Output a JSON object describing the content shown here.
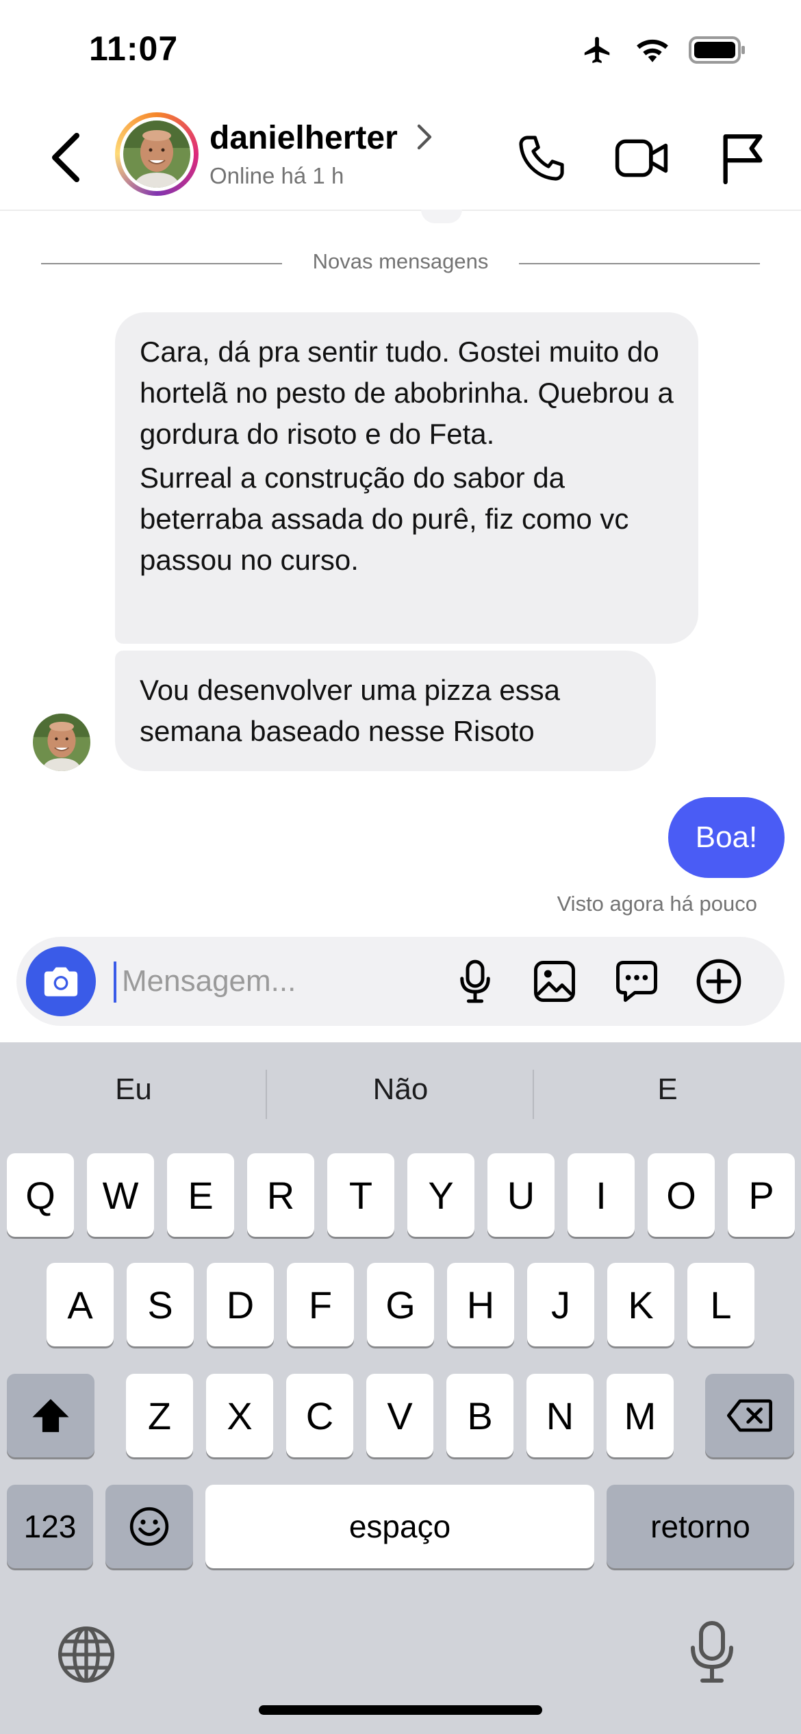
{
  "status_bar": {
    "time": "11:07"
  },
  "header": {
    "username": "danielherter",
    "status": "Online há 1 h",
    "icons": [
      "back-chevron-icon",
      "phone-icon",
      "video-icon",
      "flag-icon"
    ]
  },
  "chat": {
    "divider": "Novas mensagens",
    "messages": [
      {
        "from": "them",
        "paragraphs": [
          "Cara, dá pra sentir tudo. Gostei muito do hortelã no pesto de abobrinha. Quebrou a gordura do risoto e do Feta.",
          "Surreal a construção do sabor da beterraba assada do purê, fiz como vc passou no curso."
        ]
      },
      {
        "from": "them",
        "paragraphs": [
          "Vou desenvolver uma pizza essa semana baseado nesse Risoto"
        ]
      },
      {
        "from": "me",
        "text": "Boa!"
      }
    ],
    "seen": "Visto agora há pouco"
  },
  "composer": {
    "placeholder": "Mensagem...",
    "value": ""
  },
  "keyboard": {
    "suggestions": [
      "Eu",
      "Não",
      "E"
    ],
    "rows": [
      [
        "Q",
        "W",
        "E",
        "R",
        "T",
        "Y",
        "U",
        "I",
        "O",
        "P"
      ],
      [
        "A",
        "S",
        "D",
        "F",
        "G",
        "H",
        "J",
        "K",
        "L"
      ],
      [
        "Z",
        "X",
        "C",
        "V",
        "B",
        "N",
        "M"
      ]
    ],
    "numbers_key": "123",
    "space_key": "espaço",
    "return_key": "retorno"
  },
  "colors": {
    "accent": "#4a5cf5",
    "camera_button": "#3a5be8",
    "bubble_gray": "#efeff1",
    "keyboard_bg": "#d1d3d9"
  }
}
